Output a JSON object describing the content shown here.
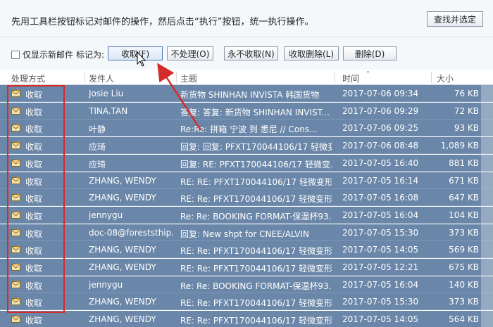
{
  "instruction": "先用工具栏按钮标记对邮件的操作，然后点击“执行”按钮，统一执行操作。",
  "find_button": "查找并选定",
  "toolbar": {
    "show_new_only": "仅显示新邮件",
    "mark_as": "标记为:",
    "buttons": [
      "收取(F)",
      "不处理(O)",
      "永不收取(N)",
      "收取删除(L)",
      "删除(D)"
    ]
  },
  "columns": {
    "action": "处理方式",
    "sender": "发件人",
    "subject": "主题",
    "time": "时间",
    "size": "大小"
  },
  "rows": [
    {
      "action": "收取",
      "sender": "Josie Liu",
      "subject": "新货物  SHINHAN INVISTA  韩国货物",
      "time": "2017-07-06 09:34",
      "size": "76 KB"
    },
    {
      "action": "收取",
      "sender": "TINA.TAN",
      "subject": "答复: 答复: 新货物  SHINHAN INVIST...",
      "time": "2017-07-06 09:29",
      "size": "72 KB"
    },
    {
      "action": "收取",
      "sender": "叶静",
      "subject": "Re:Re: 拼箱  宁波 到 悉尼  // Cons...",
      "time": "2017-07-06 09:25",
      "size": "93 KB"
    },
    {
      "action": "收取",
      "sender": "应琦",
      "subject": "回复: 回复: PFXT170044106/17 轻微变...",
      "time": "2017-07-06 08:48",
      "size": "1,089 KB"
    },
    {
      "action": "收取",
      "sender": "应琦",
      "subject": "回复: RE: PFXT170044106/17 轻微变...",
      "time": "2017-07-05 16:40",
      "size": "881 KB"
    },
    {
      "action": "收取",
      "sender": "ZHANG, WENDY",
      "subject": "RE: RE: PFXT170044106/17 轻微变形...",
      "time": "2017-07-05 16:14",
      "size": "671 KB"
    },
    {
      "action": "收取",
      "sender": "ZHANG, WENDY",
      "subject": "RE: Re: PFXT170044106/17 轻微变形...",
      "time": "2017-07-05 16:08",
      "size": "647 KB"
    },
    {
      "action": "收取",
      "sender": "jennygu",
      "subject": "Re: Re: BOOKING FORMAT-保温杯93...",
      "time": "2017-07-05 16:04",
      "size": "104 KB"
    },
    {
      "action": "收取",
      "sender": "doc-08@foreststhip...",
      "subject": "回复: New shpt for CNEE/ALVIN",
      "time": "2017-07-05 15:30",
      "size": "373 KB"
    },
    {
      "action": "收取",
      "sender": "ZHANG, WENDY",
      "subject": "RE: Re: PFXT170044106/17 轻微变形...",
      "time": "2017-07-05 14:05",
      "size": "569 KB"
    },
    {
      "action": "收取",
      "sender": "ZHANG, WENDY",
      "subject": "RE: Re: PFXT170044106/17 轻微变形...",
      "time": "2017-07-05 12:21",
      "size": "675 KB"
    },
    {
      "action": "收取",
      "sender": "jennygu",
      "subject": "Re: Re: BOOKING FORMAT-保温杯93...",
      "time": "2017-07-05 16:04",
      "size": "140 KB"
    },
    {
      "action": "收取",
      "sender": "ZHANG, WENDY",
      "subject": "RE: Re: PFXT170044106/17 轻微变形...",
      "time": "2017-07-05 15:30",
      "size": "373 KB"
    },
    {
      "action": "收取",
      "sender": "ZHANG, WENDY",
      "subject": "RE: Re: PFXT170044106/17 轻微变形...",
      "time": "2017-07-05 14:05",
      "size": "564 KB"
    }
  ],
  "colors": {
    "row_selected": "#6a86a8",
    "highlight_box": "#d62b2b",
    "arrow": "#d62b2b"
  }
}
